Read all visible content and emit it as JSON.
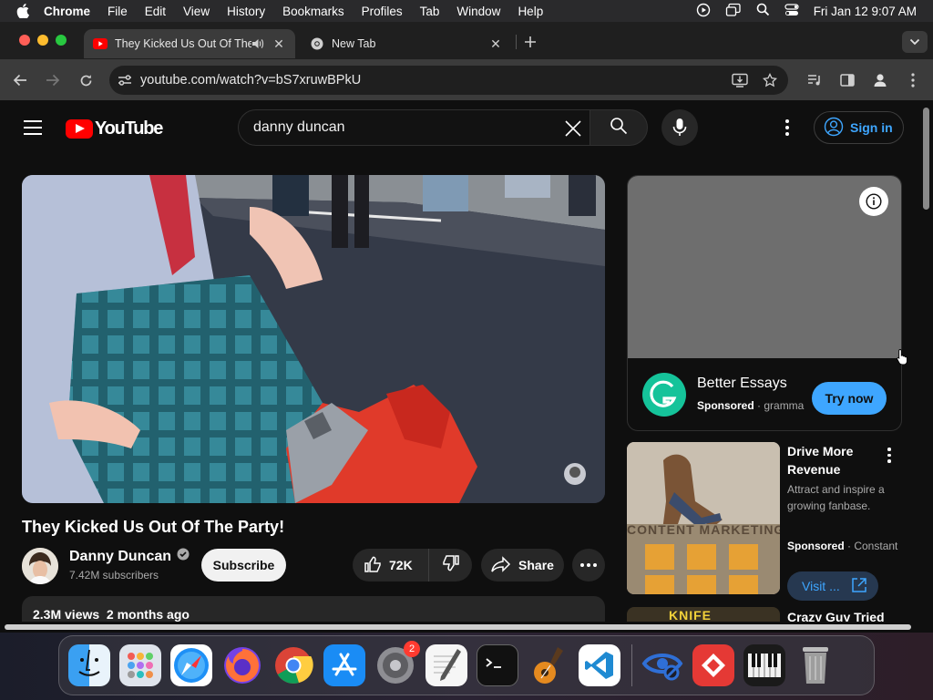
{
  "menubar": {
    "app": "Chrome",
    "items": [
      "File",
      "Edit",
      "View",
      "History",
      "Bookmarks",
      "Profiles",
      "Tab",
      "Window",
      "Help"
    ],
    "datetime": "Fri Jan 12  9:07 AM"
  },
  "tabs": [
    {
      "title": "They Kicked Us Out Of The Party!",
      "active": true
    },
    {
      "title": "New Tab",
      "active": false
    }
  ],
  "address": {
    "url": "youtube.com/watch?v=bS7xruwBPkU"
  },
  "youtube": {
    "logo_text": "YouTube",
    "search_value": "danny duncan",
    "sign_in": "Sign in",
    "video": {
      "title": "They Kicked Us Out Of The Party!",
      "channel": "Danny Duncan",
      "subscribers": "7.42M subscribers",
      "subscribe_label": "Subscribe",
      "likes": "72K",
      "share_label": "Share",
      "views_line": "2.3M views  2 months ago"
    },
    "ad": {
      "title": "Better Essays",
      "sponsored": "Sponsored",
      "domain": "grammarly.com",
      "cta": "Try now"
    },
    "rec_ad": {
      "title": "Drive More Revenue",
      "desc": "Attract and inspire a growing fanbase.",
      "sponsored": "Sponsored",
      "domain": "Constant Contact",
      "cta": "Visit ...",
      "thumb_text": "CONTENT MARKETING"
    },
    "rec_next": {
      "title": "Crazy Guy Tried",
      "thumb_text": "KNIFE"
    }
  },
  "colors": {
    "accent": "#3ea6ff",
    "yt_red": "#ff0000",
    "bg": "#0f0f0f"
  },
  "dock": {
    "notification_badge": "2"
  }
}
